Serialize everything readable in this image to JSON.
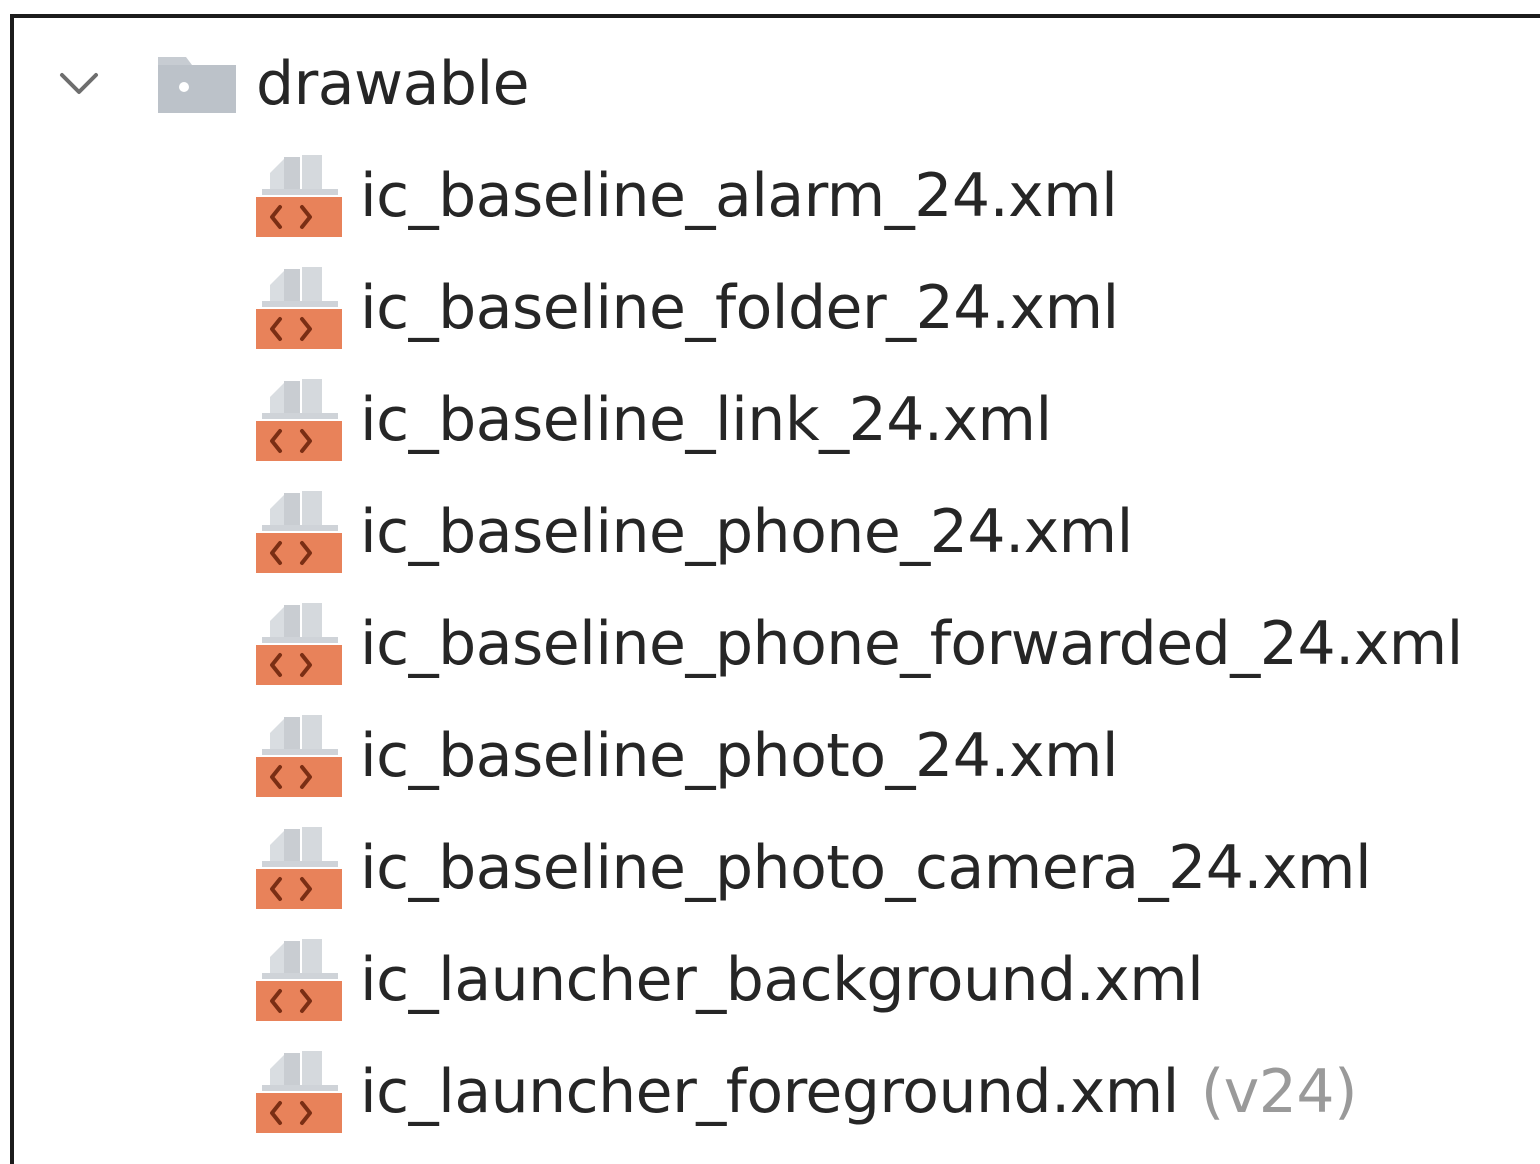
{
  "tree": {
    "folder": {
      "name": "drawable",
      "expanded": true,
      "icon": "folder-icon",
      "chevron_icon": "chevron-down-icon"
    },
    "files": [
      {
        "name": "ic_baseline_alarm_24.xml",
        "qualifier": "",
        "icon": "xml-drawable-icon"
      },
      {
        "name": "ic_baseline_folder_24.xml",
        "qualifier": "",
        "icon": "xml-drawable-icon"
      },
      {
        "name": "ic_baseline_link_24.xml",
        "qualifier": "",
        "icon": "xml-drawable-icon"
      },
      {
        "name": "ic_baseline_phone_24.xml",
        "qualifier": "",
        "icon": "xml-drawable-icon"
      },
      {
        "name": "ic_baseline_phone_forwarded_24.xml",
        "qualifier": "",
        "icon": "xml-drawable-icon"
      },
      {
        "name": "ic_baseline_photo_24.xml",
        "qualifier": "",
        "icon": "xml-drawable-icon"
      },
      {
        "name": "ic_baseline_photo_camera_24.xml",
        "qualifier": "",
        "icon": "xml-drawable-icon"
      },
      {
        "name": "ic_launcher_background.xml",
        "qualifier": "",
        "icon": "xml-drawable-icon"
      },
      {
        "name": "ic_launcher_foreground.xml",
        "qualifier": "(v24)",
        "icon": "xml-drawable-icon"
      }
    ]
  },
  "colors": {
    "text": "#262626",
    "qualifier_text": "#9a9a9a",
    "xml_badge": "#e8825a",
    "folder": "#c7ccd2"
  }
}
